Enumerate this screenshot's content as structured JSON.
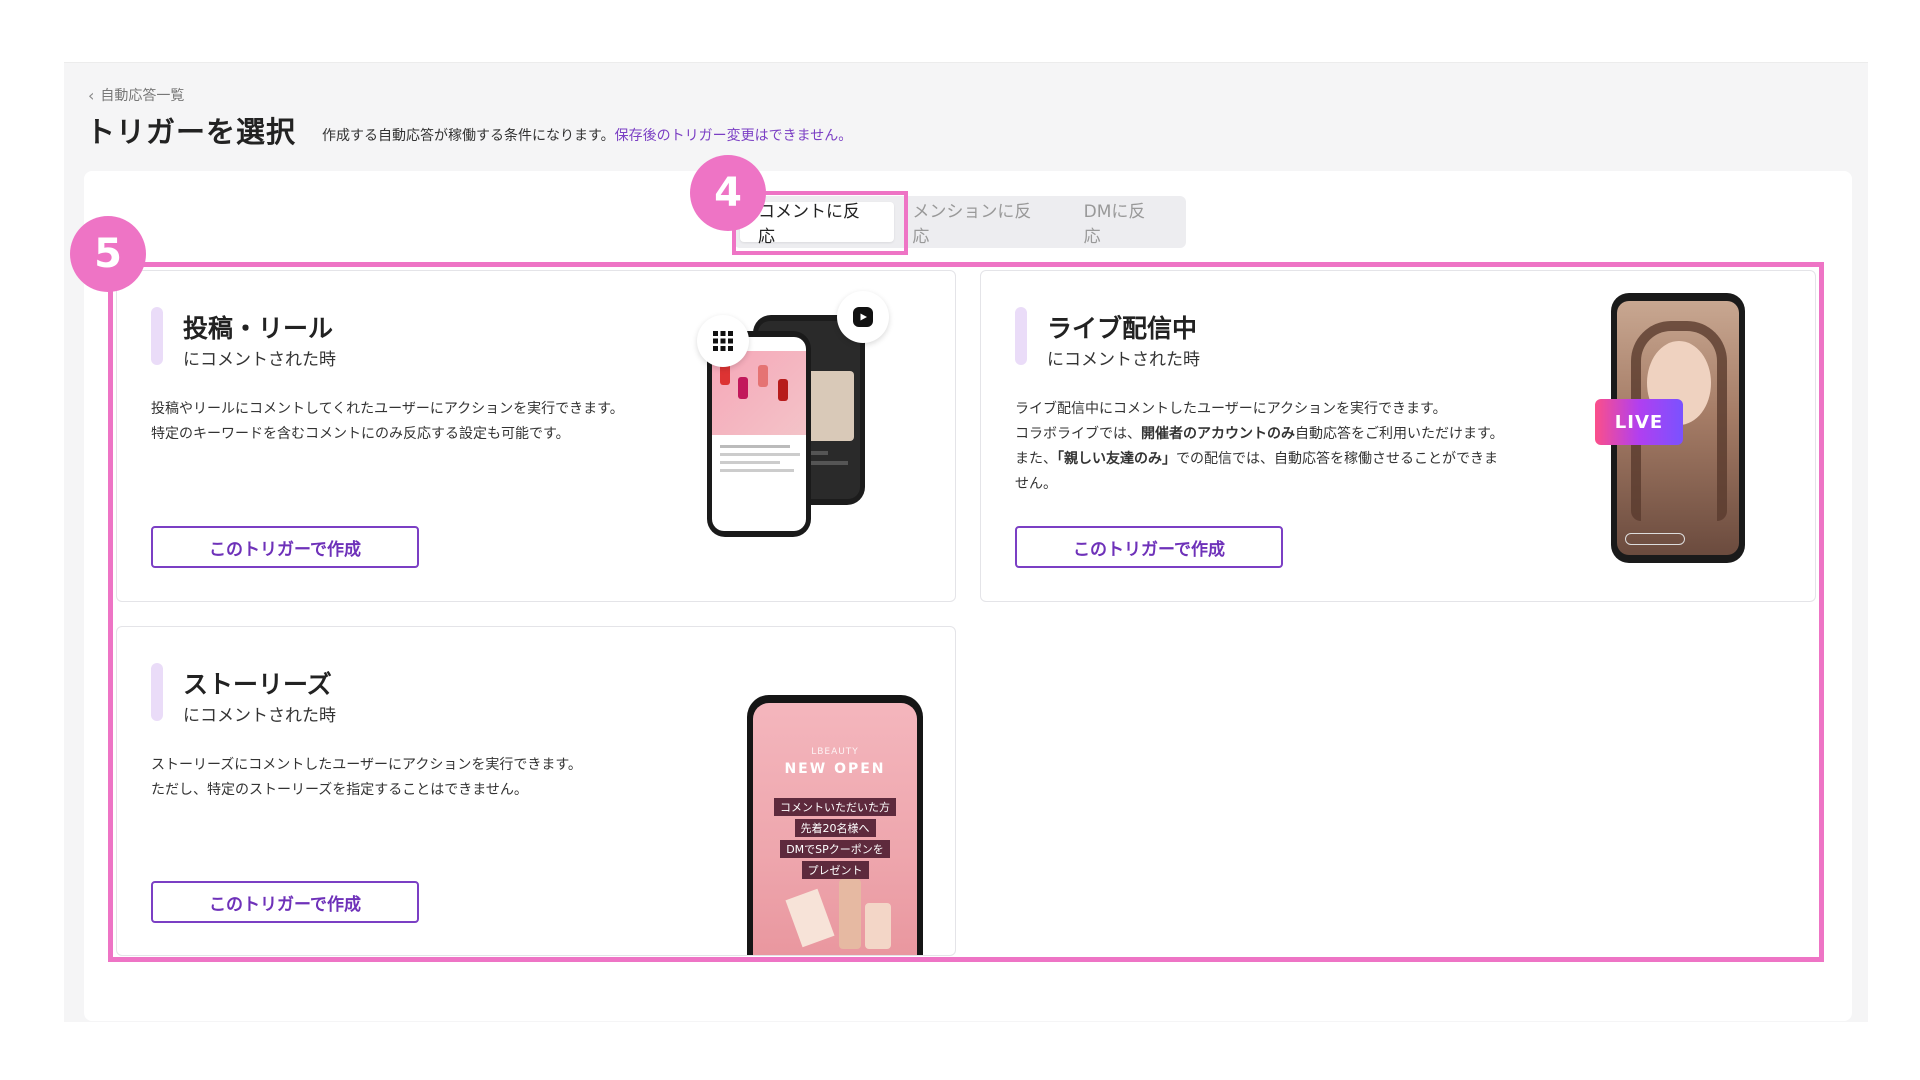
{
  "breadcrumb": {
    "back_label": "自動応答一覧"
  },
  "header": {
    "title": "トリガーを選択",
    "description": "作成する自動応答が稼働する条件になります。",
    "warning": "保存後のトリガー変更はできません。"
  },
  "tabs": [
    {
      "label": "コメントに反応",
      "active": true
    },
    {
      "label": "メンションに反応",
      "active": false
    },
    {
      "label": "DMに反応",
      "active": false
    }
  ],
  "annotations": {
    "step4": "4",
    "step5": "5",
    "highlight_color": "#ee74c5"
  },
  "cards": [
    {
      "title": "投稿・リール",
      "subtitle": "にコメントされた時",
      "body_1": "投稿やリールにコメントしてくれたユーザーにアクションを実行できます。",
      "body_2": "特定のキーワードを含むコメントにのみ反応する設定も可能です。",
      "button": "このトリガーで作成"
    },
    {
      "title": "ライブ配信中",
      "subtitle": "にコメントされた時",
      "body_1": "ライブ配信中にコメントしたユーザーにアクションを実行できます。",
      "body_2a": "コラボライブでは、",
      "body_2b": "開催者のアカウントのみ",
      "body_2c": "自動応答をご利用いただけます。また、",
      "body_2d": "「親しい友達のみ」",
      "body_2e": "での配信では、自動応答を稼働させることができません。",
      "button": "このトリガーで作成",
      "live_badge": "LIVE"
    },
    {
      "title": "ストーリーズ",
      "subtitle": "にコメントされた時",
      "body_1": "ストーリーズにコメントしたユーザーにアクションを実行できます。",
      "body_2": "ただし、特定のストーリーズを指定することはできません。",
      "button": "このトリガーで作成",
      "story": {
        "brand": "LBEAUTY",
        "headline": "NEW OPEN",
        "lines": [
          "コメントいただいた方",
          "先着20名様へ",
          "DMでSPクーポンを",
          "プレゼント"
        ]
      }
    }
  ],
  "colors": {
    "accent": "#7b3fc4",
    "tab_bg": "#ededf0",
    "panel_bg": "#f5f5f6"
  }
}
